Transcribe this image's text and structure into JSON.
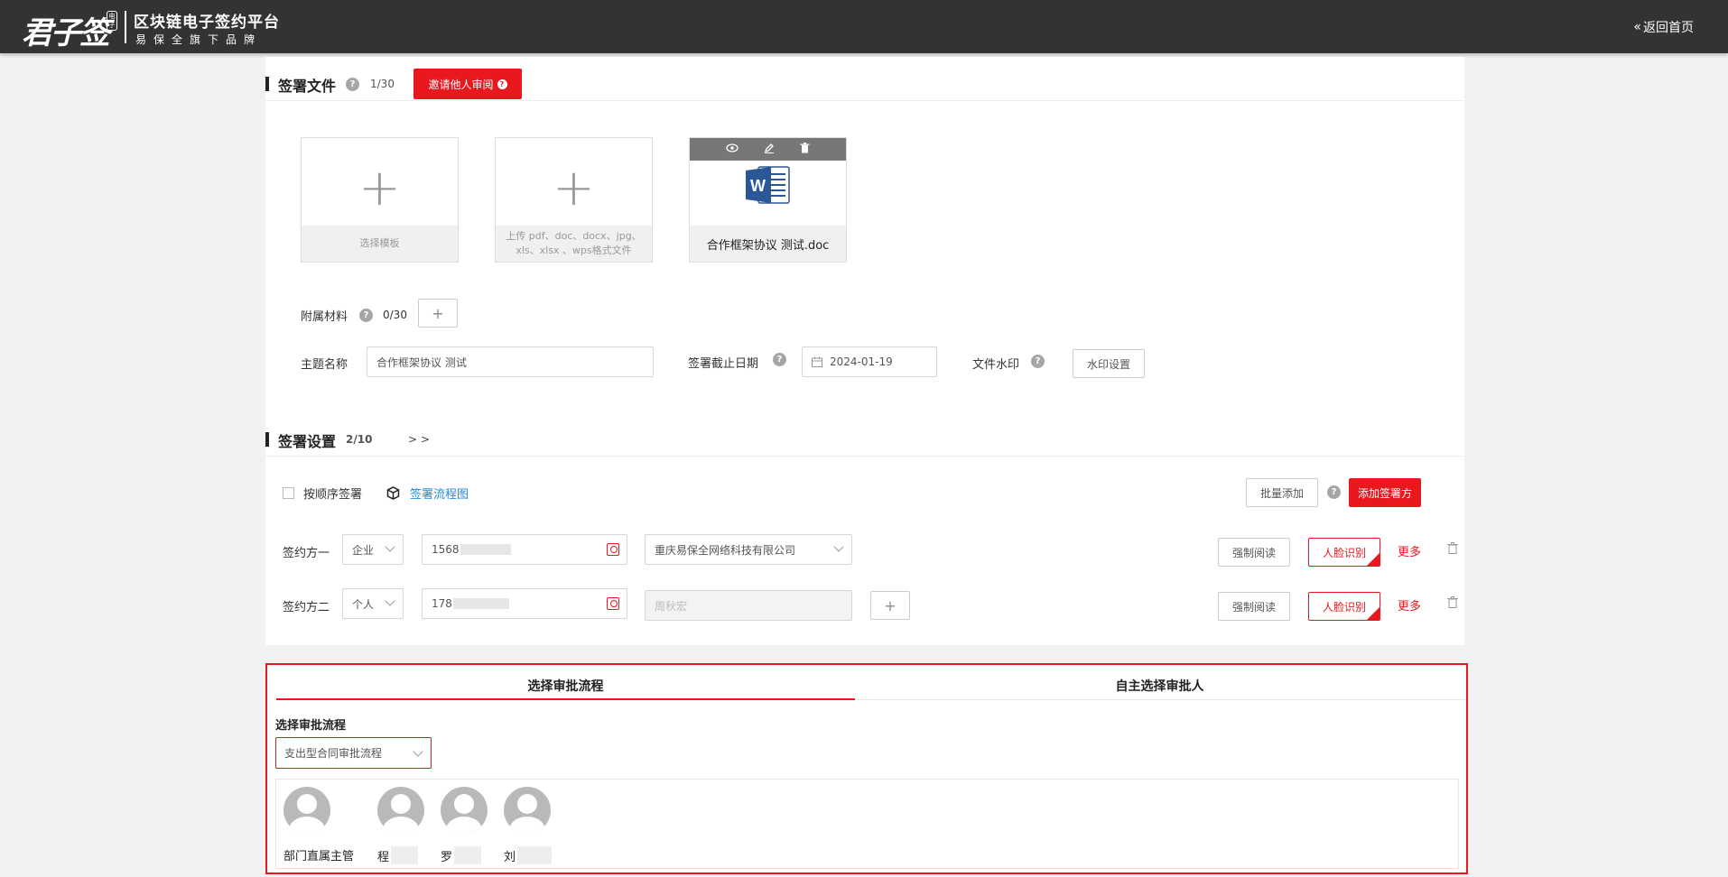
{
  "header": {
    "logo_script": "君子签",
    "logo_seal": "电子",
    "platform_title": "区块链电子签约平台",
    "platform_sub": "易保全旗下品牌",
    "back_home": "返回首页"
  },
  "sign_files": {
    "title": "签署文件",
    "count": "1/30",
    "invite_review_label": "邀请他人审阅",
    "template_tile_label": "选择模板",
    "upload_tile_label": "上传 pdf、doc、docx、jpg、xls、xlsx 、wps格式文件",
    "file_name": "合作框架协议 测试.doc"
  },
  "attachments": {
    "label": "附属材料",
    "count": "0/30",
    "add_label": "+"
  },
  "subject": {
    "label": "主题名称",
    "value": "合作框架协议 测试"
  },
  "deadline": {
    "label": "签署截止日期",
    "value": "2024-01-19"
  },
  "watermark": {
    "label": "文件水印",
    "button_label": "水印设置"
  },
  "sign_settings": {
    "title": "签署设置",
    "count": "2/10",
    "expand": "> >",
    "sequential_label": "按顺序签署",
    "flow_chart_label": "签署流程图",
    "batch_add_label": "批量添加",
    "add_signer_label": "添加签署方"
  },
  "signers": [
    {
      "label": "签约方一",
      "type": "企业",
      "phone_prefix": "1568",
      "name_value": "重庆易保全网络科技有限公司",
      "force_read": "强制阅读",
      "face_id": "人脸识别",
      "more": "更多"
    },
    {
      "label": "签约方二",
      "type": "个人",
      "phone_prefix": "178",
      "name_value": "周秋宏",
      "force_read": "强制阅读",
      "face_id": "人脸识别",
      "more": "更多"
    }
  ],
  "approval": {
    "tabs": [
      "选择审批流程",
      "自主选择审批人"
    ],
    "section_label": "选择审批流程",
    "selected_flow": "支出型合同审批流程",
    "approvers": [
      {
        "name": "部门直属主管"
      },
      {
        "name": "程"
      },
      {
        "name": "罗"
      },
      {
        "name": "刘"
      }
    ]
  },
  "colors": {
    "accent_red": "#e8181e",
    "topbar": "#333333",
    "link_blue": "#1a8fd9"
  }
}
